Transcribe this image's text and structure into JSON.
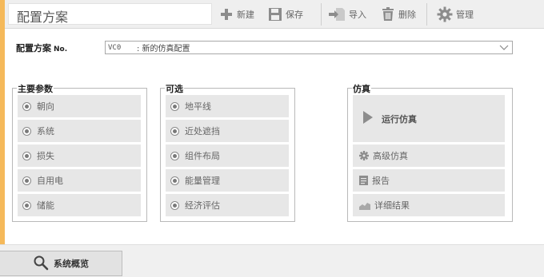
{
  "header": {
    "title": "配置方案",
    "toolbar": {
      "new_label": "新建",
      "save_label": "保存",
      "import_label": "导入",
      "delete_label": "删除",
      "manage_label": "管理"
    }
  },
  "config": {
    "label": "配置方案",
    "label_suffix": "No.",
    "selected_code": "VC0",
    "selected_desc": ": 新的仿真配置"
  },
  "groups": {
    "main": {
      "title": "主要参数",
      "items": [
        "朝向",
        "系统",
        "损失",
        "自用电",
        "储能"
      ]
    },
    "optional": {
      "title": "可选",
      "items": [
        "地平线",
        "近处遮挡",
        "组件布局",
        "能量管理",
        "经济评估"
      ]
    },
    "simulation": {
      "title": "仿真",
      "run_label": "运行仿真",
      "advanced_label": "高级仿真",
      "report_label": "报告",
      "details_label": "详细结果"
    }
  },
  "footer": {
    "overview_label": "系统概览"
  },
  "colors": {
    "accent": "#f5b95a",
    "button_bg": "#e7e7e7"
  }
}
